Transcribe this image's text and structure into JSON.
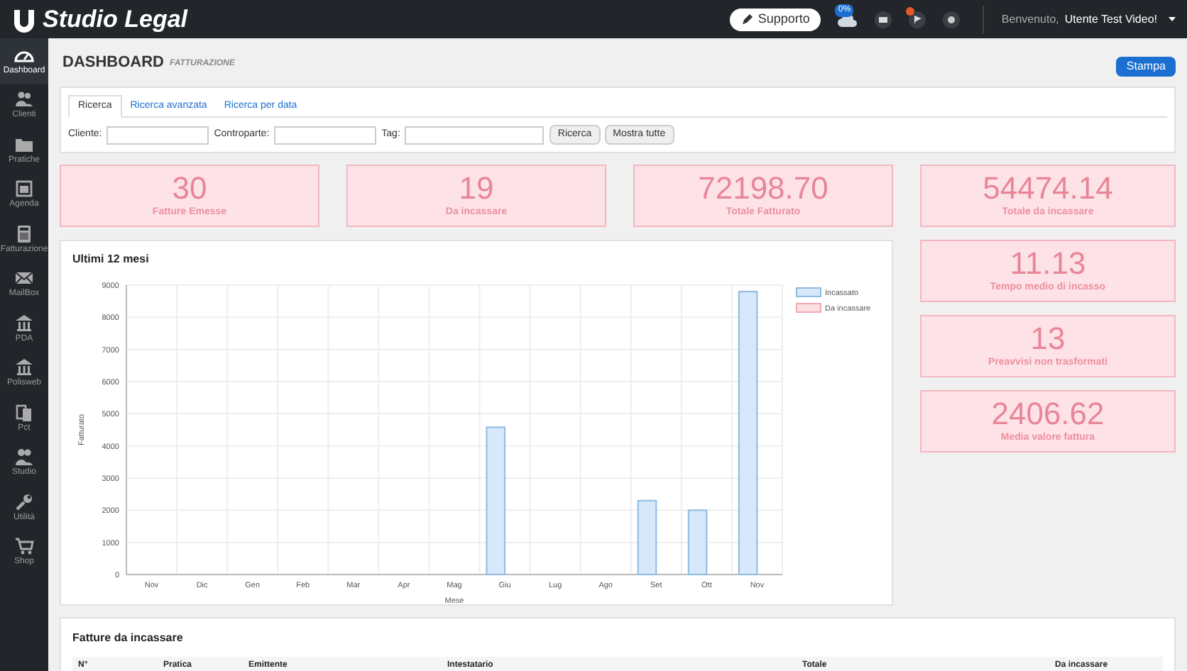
{
  "app": {
    "logo_text": "Studio Legal"
  },
  "topbar": {
    "support_button": "Supporto",
    "cloud_badge": "0%",
    "welcome": "Benvenuto,",
    "user": "Utente Test Video!"
  },
  "sidebar": {
    "items": [
      {
        "label": "Dashboard",
        "selected": true
      },
      {
        "label": "Clienti",
        "selected": false
      },
      {
        "label": "Pratiche",
        "selected": false
      },
      {
        "label": "Agenda",
        "selected": false
      },
      {
        "label": "Fatturazione",
        "selected": false
      },
      {
        "label": "MailBox",
        "selected": false
      },
      {
        "label": "PDA",
        "selected": false
      },
      {
        "label": "Polisweb",
        "selected": false
      },
      {
        "label": "Pct",
        "selected": false
      },
      {
        "label": "Studio",
        "selected": false
      },
      {
        "label": "Utilità",
        "selected": false
      },
      {
        "label": "Shop",
        "selected": false
      }
    ]
  },
  "page": {
    "title": "DASHBOARD",
    "subtitle": "FATTURAZIONE",
    "print_button": "Stampa"
  },
  "search": {
    "tabs": [
      {
        "label": "Ricerca",
        "selected": true
      },
      {
        "label": "Ricerca avanzata",
        "selected": false
      },
      {
        "label": "Ricerca per data",
        "selected": false
      }
    ],
    "fields": [
      {
        "label": "Cliente:"
      },
      {
        "label": "Controparte:"
      },
      {
        "label": "Tag:"
      }
    ],
    "buttons": [
      "Ricerca",
      "Mostra tutte"
    ]
  },
  "stats_row": [
    {
      "value": "30",
      "label": "Fatture Emesse"
    },
    {
      "value": "19",
      "label": "Da incassare"
    },
    {
      "value": "72198.70",
      "label": "Totale Fatturato"
    }
  ],
  "stats_column": [
    {
      "value": "54474.14",
      "label": "Totale da incassare"
    },
    {
      "value": "11.13",
      "label": "Tempo medio di incasso"
    },
    {
      "value": "13",
      "label": "Preavvisi non trasformati"
    },
    {
      "value": "2406.62",
      "label": "Media valore fattura"
    }
  ],
  "chart_card": {
    "title": "Ultimi 12 mesi",
    "chart_data": {
      "type": "bar",
      "xlabel": "Mese",
      "ylabel": "Fatturato",
      "categories": [
        "Nov",
        "Dic",
        "Gen",
        "Feb",
        "Mar",
        "Apr",
        "Mag",
        "Giu",
        "Lug",
        "Ago",
        "Set",
        "Ott",
        "Nov"
      ],
      "series": [
        {
          "name": "Incassato",
          "color": "#d6e8fa",
          "values": [
            0,
            0,
            0,
            0,
            0,
            0,
            0,
            4580,
            0,
            0,
            2300,
            2000,
            8800
          ]
        },
        {
          "name": "Da incassare",
          "color": "#fde0e4",
          "values": [
            0,
            0,
            0,
            0,
            0,
            0,
            0,
            0,
            0,
            0,
            0,
            0,
            0
          ]
        }
      ],
      "grid": true,
      "ylim": [
        0,
        9000
      ],
      "yticks": [
        0,
        1000,
        2000,
        3000,
        4000,
        5000,
        6000,
        7000,
        8000,
        9000
      ]
    }
  },
  "invoices": {
    "title": "Fatture da incassare",
    "columns": [
      "N°",
      "Pratica",
      "Emittente",
      "Intestatario",
      "Totale",
      "Da incassare"
    ]
  }
}
